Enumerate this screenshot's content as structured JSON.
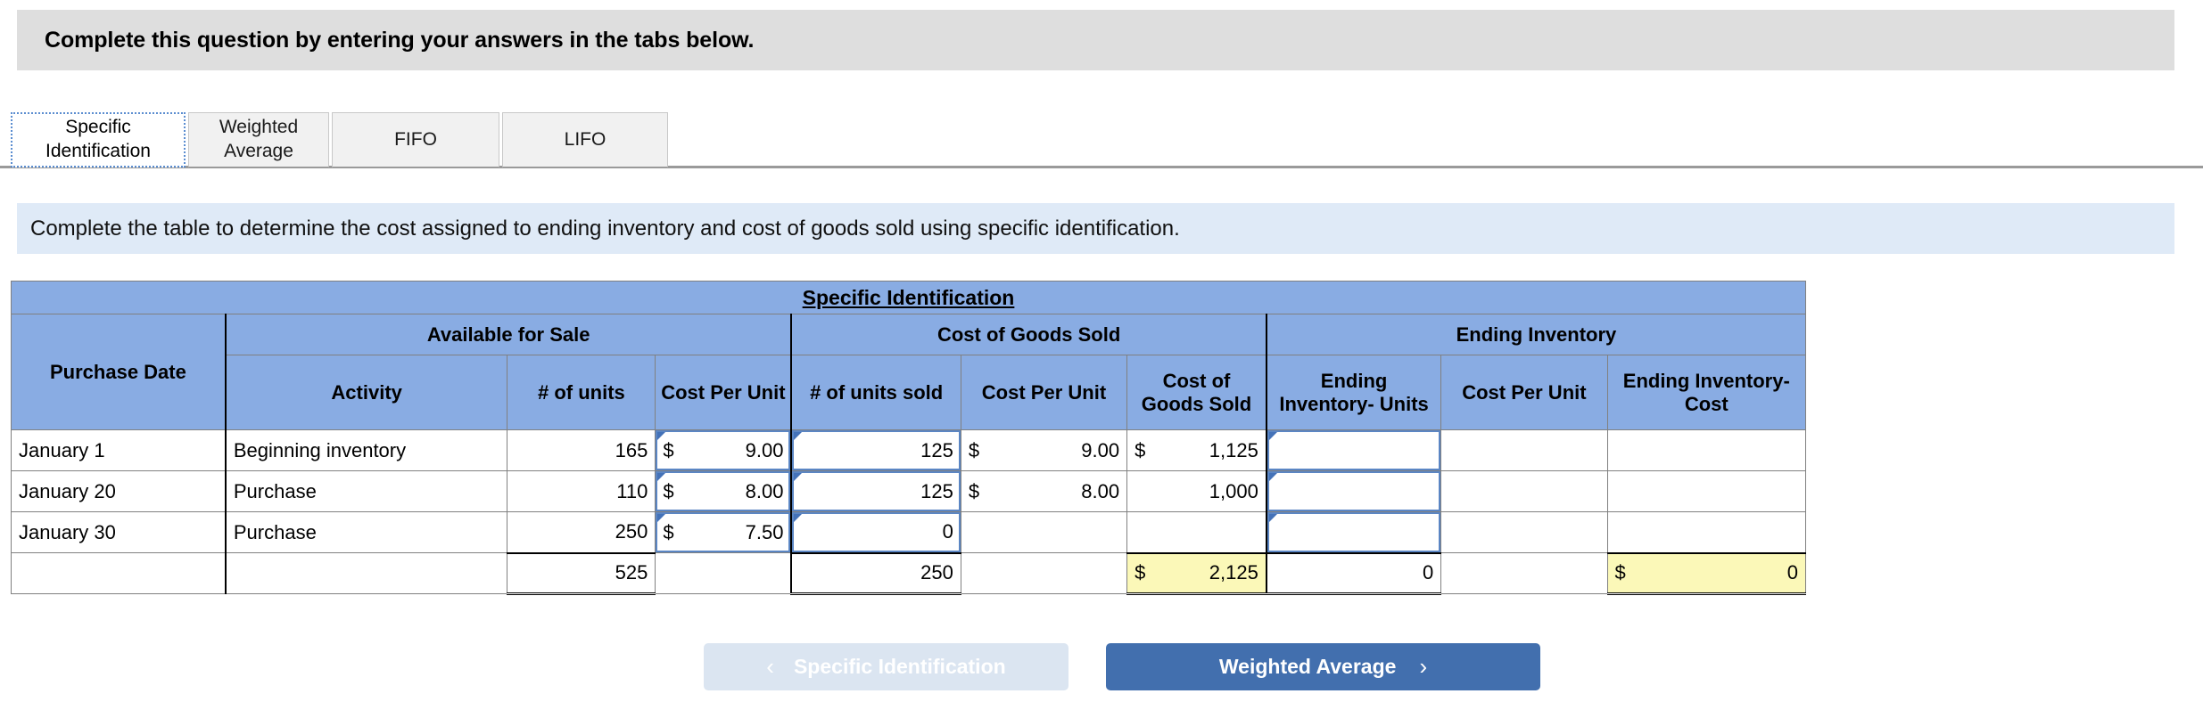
{
  "question": {
    "banner_text": "Complete this question by entering your answers in the tabs below."
  },
  "tabs": [
    {
      "label": "Specific\nIdentification",
      "line1": "Specific",
      "line2": "Identification",
      "active": true
    },
    {
      "label": "Weighted Average",
      "line1": "Weighted",
      "line2": "Average",
      "active": false
    },
    {
      "label": "FIFO",
      "line1": "FIFO",
      "line2": "",
      "active": false
    },
    {
      "label": "LIFO",
      "line1": "LIFO",
      "line2": "",
      "active": false
    }
  ],
  "instruction": {
    "text": "Complete the table to determine the cost assigned to ending inventory and cost of goods sold using specific identification."
  },
  "table": {
    "title": "Specific Identification",
    "group_headers": {
      "purchase_date": "Purchase Date",
      "available_for_sale": "Available for Sale",
      "cost_of_goods_sold": "Cost of Goods Sold",
      "ending_inventory": "Ending Inventory"
    },
    "column_headers": {
      "activity": "Activity",
      "afs_units": "# of units",
      "afs_cost_per_unit": "Cost Per Unit",
      "cogs_units_sold": "# of units sold",
      "cogs_cost_per_unit": "Cost Per Unit",
      "cogs_cost": "Cost of Goods Sold",
      "ei_units": "Ending Inventory- Units",
      "ei_cost_per_unit": "Cost Per Unit",
      "ei_cost": "Ending Inventory- Cost"
    },
    "rows": [
      {
        "date": "January 1",
        "activity": "Beginning inventory",
        "afs_units": "165",
        "afs_cpu_symbol": "$",
        "afs_cpu": "9.00",
        "cogs_units": "125",
        "cogs_cpu_symbol": "$",
        "cogs_cpu": "9.00",
        "cogs_cost_symbol": "$",
        "cogs_cost": "1,125",
        "ei_units": "",
        "ei_cpu": "",
        "ei_cost": ""
      },
      {
        "date": "January 20",
        "activity": "Purchase",
        "afs_units": "110",
        "afs_cpu_symbol": "$",
        "afs_cpu": "8.00",
        "cogs_units": "125",
        "cogs_cpu_symbol": "$",
        "cogs_cpu": "8.00",
        "cogs_cost_symbol": "",
        "cogs_cost": "1,000",
        "ei_units": "",
        "ei_cpu": "",
        "ei_cost": ""
      },
      {
        "date": "January 30",
        "activity": "Purchase",
        "afs_units": "250",
        "afs_cpu_symbol": "$",
        "afs_cpu": "7.50",
        "cogs_units": "0",
        "cogs_cpu_symbol": "",
        "cogs_cpu": "",
        "cogs_cost_symbol": "",
        "cogs_cost": "",
        "ei_units": "",
        "ei_cpu": "",
        "ei_cost": ""
      }
    ],
    "totals": {
      "date": "",
      "activity": "",
      "afs_units": "525",
      "afs_cpu": "",
      "cogs_units": "250",
      "cogs_cpu": "",
      "cogs_cost_symbol": "$",
      "cogs_cost": "2,125",
      "ei_units": "0",
      "ei_cpu": "",
      "ei_cost_symbol": "$",
      "ei_cost": "0"
    }
  },
  "nav": {
    "prev_label": "Specific Identification",
    "prev_chevron": "‹",
    "next_label": "Weighted Average",
    "next_chevron": "›"
  },
  "colors": {
    "header_blue": "#89ACE3",
    "highlight_yellow": "#FBF8B8",
    "banner_grey": "#DEDEDE",
    "instruction_blue": "#DFEAF7",
    "button_blue": "#426FAE",
    "button_disabled": "#DBE5F1",
    "input_border": "#5B86C4"
  }
}
